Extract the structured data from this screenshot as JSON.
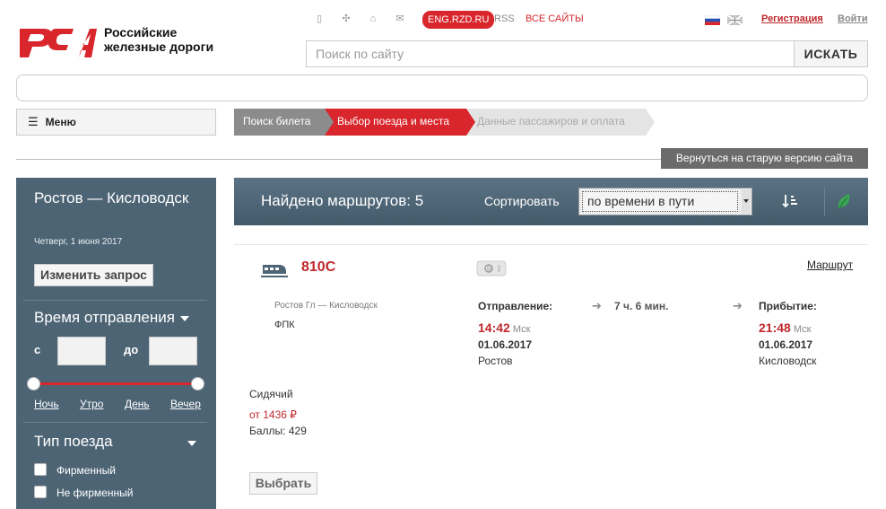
{
  "brand": {
    "line1": "Российские",
    "line2": "железные дороги",
    "primary_color": "#d8262c"
  },
  "topbar": {
    "icons": [
      "mobile-icon",
      "sitemap-icon",
      "home-icon",
      "mail-icon"
    ],
    "eng_label": "ENG.RZD.RU",
    "rss_label": "RSS",
    "all_sites_label": "ВСЕ САЙТЫ",
    "register_label": "Регистрация",
    "login_label": "Войти"
  },
  "search": {
    "placeholder": "Поиск по сайту",
    "button_label": "ИСКАТЬ"
  },
  "menu": {
    "label": "Меню"
  },
  "steps": [
    {
      "label": "Поиск билета",
      "state": "done"
    },
    {
      "label": "Выбор поезда и места",
      "state": "active"
    },
    {
      "label": "Данные пассажиров и оплата",
      "state": "pending"
    }
  ],
  "old_version_label": "Вернуться на старую версию сайта",
  "sidebar": {
    "route_title": "Ростов — Кисловодск",
    "route_date": "Четверг, 1 июня 2017",
    "change_label": "Изменить запрос",
    "departure_title": "Время отправления",
    "from_label": "с",
    "to_label": "до",
    "times_of_day": [
      "Ночь",
      "Утро",
      "День",
      "Вечер"
    ],
    "train_type_title": "Тип поезда",
    "train_types": [
      {
        "label": "Фирменный",
        "checked": false
      },
      {
        "label": "Не фирменный",
        "checked": false
      }
    ]
  },
  "results": {
    "found_label": "Найдено маршрутов: 5",
    "sort_label": "Сортировать",
    "sort_value": "по времени в пути"
  },
  "train": {
    "number": "810С",
    "route_link": "Маршрут",
    "route_name": "Ростов Гл — Кисловодск",
    "carrier": "ФПК",
    "departure_label": "Отправление:",
    "duration": "7 ч. 6 мин.",
    "arrival_label": "Прибытие:",
    "dep_time": "14:42",
    "arr_time": "21:48",
    "tz": "Мск",
    "dep_date": "01.06.2017",
    "arr_date": "01.06.2017",
    "dep_station": "Ростов",
    "arr_station": "Кисловодск",
    "seat_type": "Сидячий",
    "price": "от 1436 ₽",
    "points": "Баллы: 429",
    "choose_label": "Выбрать"
  }
}
